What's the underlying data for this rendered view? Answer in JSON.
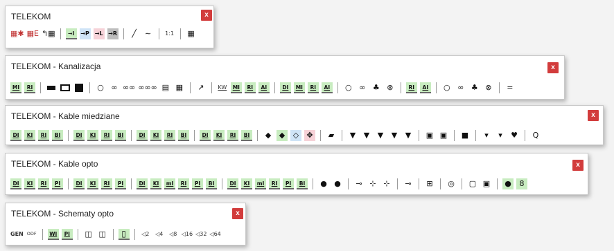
{
  "toolbars": [
    {
      "title": "TELEKOM",
      "close": "x",
      "groups": [
        [
          "▦✱",
          "▦E",
          "↰▦"
        ],
        [
          "→I",
          "→P",
          "→L",
          "→R"
        ],
        [
          "╱",
          "∼"
        ],
        [
          "1:1"
        ],
        [
          "▦"
        ]
      ]
    },
    {
      "title": "TELEKOM - Kanalizacja",
      "close": "x",
      "groups": [
        [
          "MI",
          "RI"
        ],
        [
          "▬",
          "▭",
          "■"
        ],
        [
          "○",
          "∞",
          "∞∞",
          "∞∞∞",
          "▤",
          "▦"
        ],
        [
          "↗"
        ],
        [
          "KW",
          "MI",
          "RI",
          "AI"
        ],
        [
          "DI",
          "MI",
          "RI",
          "AI"
        ],
        [
          "○",
          "∞",
          "♣",
          "⊗"
        ],
        [
          "RI",
          "AI"
        ],
        [
          "○",
          "∞",
          "♣",
          "⊗"
        ],
        [
          "="
        ]
      ]
    },
    {
      "title": "TELEKOM - Kable miedziane",
      "close": "x",
      "groups": [
        [
          "DI",
          "KI",
          "RI",
          "BI"
        ],
        [
          "DI",
          "KI",
          "RI",
          "BI"
        ],
        [
          "DI",
          "KI",
          "RI",
          "BI"
        ],
        [
          "DI",
          "KI",
          "RI",
          "BI"
        ],
        [
          "◆",
          "◆",
          "◇",
          "✥"
        ],
        [
          "▰"
        ],
        [
          "▼",
          "▼",
          "▼",
          "▼",
          "▼"
        ],
        [
          "▣",
          "▣"
        ],
        [
          "■"
        ],
        [
          "▾",
          "▾",
          "♥"
        ],
        [
          "Q"
        ]
      ]
    },
    {
      "title": "TELEKOM - Kable opto",
      "close": "x",
      "groups": [
        [
          "DI",
          "KI",
          "RI",
          "PI"
        ],
        [
          "DI",
          "KI",
          "RI",
          "PI"
        ],
        [
          "DI",
          "KI",
          "mI",
          "RI",
          "PI",
          "BI"
        ],
        [
          "DI",
          "KI",
          "mI",
          "RI",
          "PI",
          "BI"
        ],
        [
          "●",
          "●"
        ],
        [
          "⊸",
          "⊹",
          "⊹"
        ],
        [
          "⊸"
        ],
        [
          "⊞"
        ],
        [
          "◎"
        ],
        [
          "▢",
          "▣"
        ],
        [
          "●",
          "8"
        ]
      ]
    },
    {
      "title": "TELEKOM - Schematy opto",
      "close": "x",
      "groups": [
        [
          "GEN",
          "ODF"
        ],
        [
          "WI",
          "PI"
        ],
        [
          "◫",
          "◫"
        ],
        [
          "▯"
        ],
        [
          "◁2",
          "◁4",
          "◁8",
          "◁16",
          "◁32",
          "◁64"
        ]
      ]
    }
  ]
}
